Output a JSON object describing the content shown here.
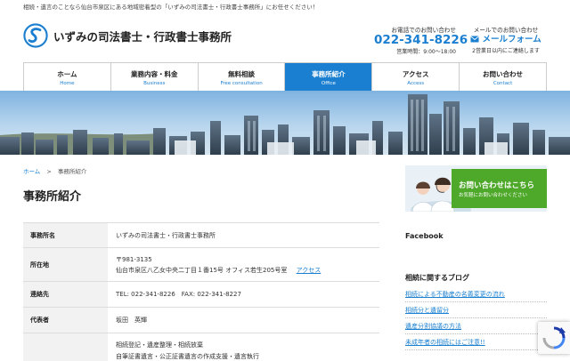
{
  "topbar": {
    "text": "相続・遺言のことなら仙台市泉区にある地域密着型の「いずみの司法書士・行政書士事務所」にお任せください！"
  },
  "header": {
    "logo_text": "いずみの司法書士・行政書士事務所",
    "tel_label": "お電話でのお問い合わせ",
    "tel_number": "022-341-8226",
    "hours": "営業時間：9:00〜18:00",
    "mail_label": "メールでのお問い合わせ",
    "mail_link": "メールフォーム",
    "mail_note": "2営業日以内にご連絡します",
    "brand_color": "#1a7fd0"
  },
  "nav": {
    "items": [
      {
        "jp": "ホーム",
        "en": "Home"
      },
      {
        "jp": "業務内容・料金",
        "en": "Business"
      },
      {
        "jp": "無料相談",
        "en": "Free consultation"
      },
      {
        "jp": "事務所紹介",
        "en": "Office"
      },
      {
        "jp": "アクセス",
        "en": "Access"
      },
      {
        "jp": "お問い合わせ",
        "en": "Contact"
      }
    ],
    "active": "Office"
  },
  "breadcrumb": {
    "home": "ホーム",
    "separator": ">",
    "current": "事務所紹介"
  },
  "page": {
    "title": "事務所紹介"
  },
  "office_table": {
    "rows": [
      {
        "label": "事務所名",
        "value": "いずみの司法書士・行政書士事務所"
      },
      {
        "label": "所在地",
        "postal": "〒981-3135",
        "address": "仙台市泉区八乙女中央二丁目１番15号 オフィス若生205号室",
        "link": "アクセス"
      },
      {
        "label": "連絡先",
        "value": "TEL: 022-341-8226　FAX: 022-341-8227"
      },
      {
        "label": "代表者",
        "value": "坂田　英輝"
      },
      {
        "label": "",
        "line1": "相続登記・遺産整理・相続放棄",
        "line2": "自筆証書遺言・公正証書遺言の作成支援・遺言執行"
      }
    ]
  },
  "sidebar": {
    "banner_title": "お問い合わせはこちら",
    "banner_sub": "お気軽にお問い合わせください",
    "facebook": "Facebook",
    "blog_heading": "相続に関するブログ",
    "blog_items": [
      "相続による不動産の名義変更の流れ",
      "相続分と遺留分",
      "遺産分割協議の方法",
      "未成年者の相続にはご注意!!"
    ]
  }
}
